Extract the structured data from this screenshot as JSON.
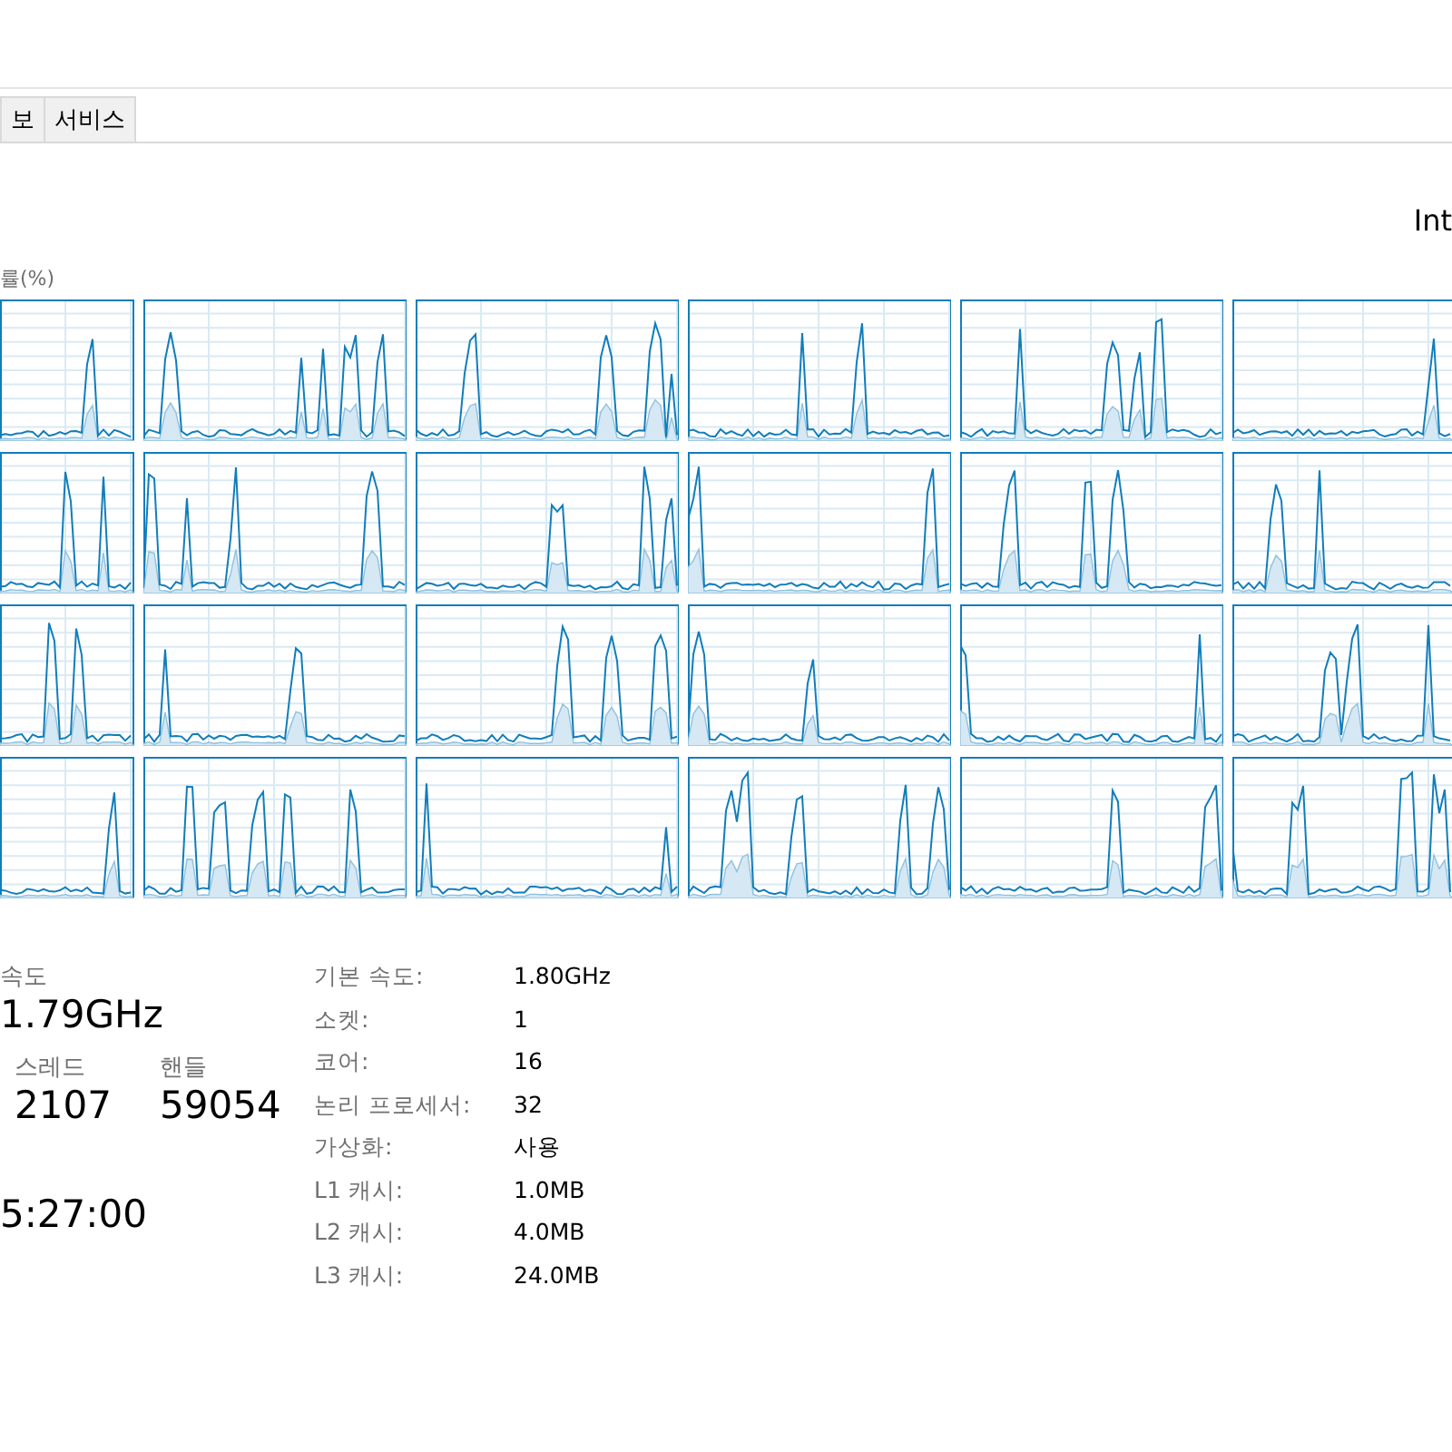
{
  "tabs": [
    {
      "label": "보",
      "selected": false
    },
    {
      "label": "서비스",
      "selected": false
    }
  ],
  "processor_name": "Int",
  "graph_label": "률(%)",
  "speed": {
    "label": "속도",
    "value": "1.79GHz"
  },
  "counters": [
    {
      "label": "스레드",
      "value": "2107"
    },
    {
      "label": "핸들",
      "value": "59054"
    }
  ],
  "uptime": "5:27:00",
  "specs": [
    {
      "label": "기본 속도:",
      "value": "1.80GHz"
    },
    {
      "label": "소켓:",
      "value": "1"
    },
    {
      "label": "코어:",
      "value": "16"
    },
    {
      "label": "논리 프로세서:",
      "value": "32"
    },
    {
      "label": "가상화:",
      "value": "사용"
    },
    {
      "label": "L1 캐시:",
      "value": "1.0MB"
    },
    {
      "label": "L2 캐시:",
      "value": "4.0MB"
    },
    {
      "label": "L3 캐시:",
      "value": "24.0MB"
    }
  ]
}
